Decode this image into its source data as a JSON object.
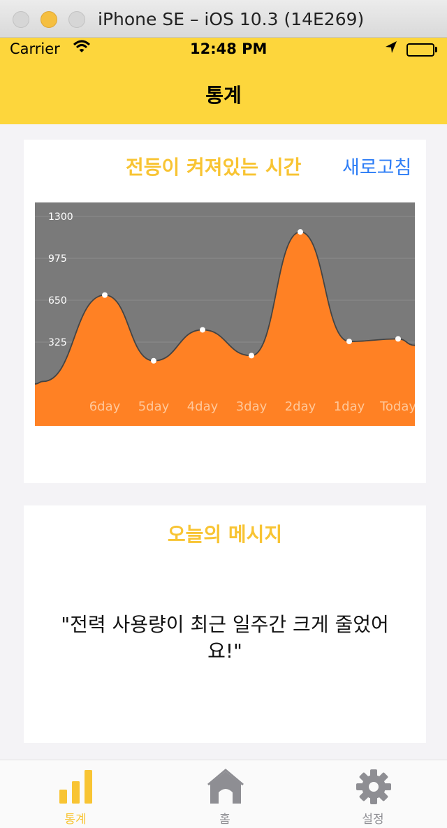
{
  "window": {
    "title": "iPhone SE – iOS 10.3 (14E269)"
  },
  "status_bar": {
    "carrier": "Carrier",
    "time": "12:48 PM"
  },
  "nav": {
    "title": "통계"
  },
  "chart_card": {
    "title": "전등이 켜져있는 시간",
    "refresh_label": "새로고침"
  },
  "message_card": {
    "title": "오늘의 메시지",
    "text": "\"전력 사용량이 최근 일주간 크게 줄었어요!\""
  },
  "tabs": [
    {
      "label": "통계",
      "icon": "bar-chart-icon",
      "active": true
    },
    {
      "label": "홈",
      "icon": "home-icon",
      "active": false
    },
    {
      "label": "설정",
      "icon": "gear-icon",
      "active": false
    }
  ],
  "colors": {
    "accent_yellow": "#fdd63c",
    "title_yellow": "#f8c433",
    "link_blue": "#2d7df6",
    "chart_background": "#7a7a7a",
    "chart_fill": "#ff8124",
    "tab_active": "#f8c433",
    "tab_inactive": "#8e8e93"
  },
  "chart_data": {
    "type": "area",
    "categories": [
      "6day",
      "5day",
      "4day",
      "3day",
      "2day",
      "1day",
      "Today"
    ],
    "values": [
      690,
      180,
      420,
      220,
      1180,
      330,
      350
    ],
    "ylim": [
      0,
      1300
    ],
    "yticks": [
      "0",
      "325",
      "650",
      "975",
      "1300"
    ],
    "grid": true,
    "smooth": true
  }
}
